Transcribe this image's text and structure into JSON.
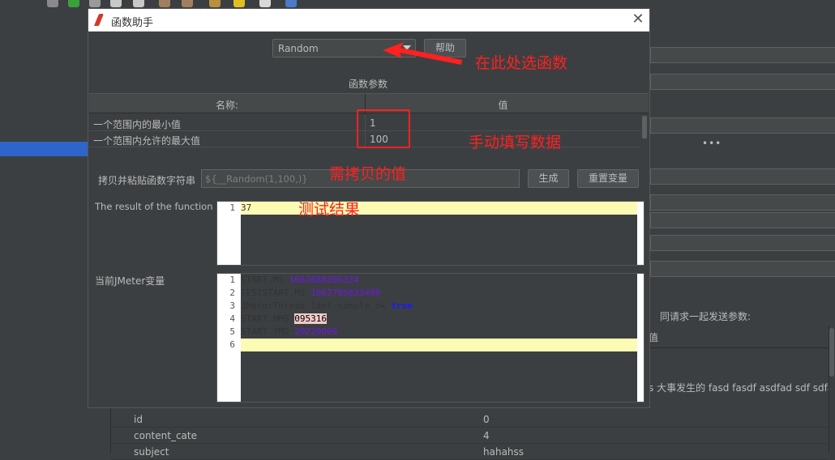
{
  "background": {
    "params_label": "同请求一起发送参数:",
    "value_header": "值",
    "long_value": "s 大事发生的 fasd fasdf asdfad sdf sdfa...",
    "rows": [
      {
        "name": "id",
        "value": "0"
      },
      {
        "name": "content_cate",
        "value": "4"
      },
      {
        "name": "subject",
        "value": "hahahss"
      }
    ],
    "dots": "•••"
  },
  "dialog": {
    "title": "函数助手",
    "close_glyph": "✕",
    "function_select": {
      "selected": "Random"
    },
    "help_button": "帮助",
    "params_title": "函数参数",
    "params_table": {
      "headers": [
        "名称:",
        "值"
      ],
      "rows": [
        {
          "name": "一个范围内的最小值",
          "value": "1"
        },
        {
          "name": "一个范围内允许的最大值",
          "value": "100"
        }
      ]
    },
    "copy_label": "拷贝并粘贴函数字符串",
    "copy_value": "${__Random(1,100,)}",
    "generate_button": "生成",
    "reset_button": "重置变量",
    "result_label": "The result of the function is",
    "result_lines": [
      {
        "no": "1",
        "text": "37"
      }
    ],
    "vars_label": "当前JMeter变量",
    "vars_lines": [
      {
        "no": "1",
        "key": "START.MS ",
        "val": "1662688396324"
      },
      {
        "no": "2",
        "key": "TESTSTART.MS ",
        "val": "1662705833490"
      },
      {
        "no": "3",
        "key": "JMeterThread.last_sample_ok ",
        "val": "true"
      },
      {
        "no": "4",
        "key": "START.HMS ",
        "val": "095316"
      },
      {
        "no": "5",
        "key": "START.YMD ",
        "val": "20220909"
      },
      {
        "no": "6",
        "key": "",
        "val": ""
      }
    ]
  },
  "annotations": {
    "select_here": "在此处选函数",
    "fill_data": "手动填写数据",
    "copy_value": "需拷贝的值",
    "test_result": "测试结果"
  },
  "colors": {
    "annotation": "#ff2020",
    "highlight_line": "#fbfbb4",
    "number_purple": "#6f18e5",
    "keyword_blue": "#1a1aff",
    "selection": "#2f65ca"
  }
}
